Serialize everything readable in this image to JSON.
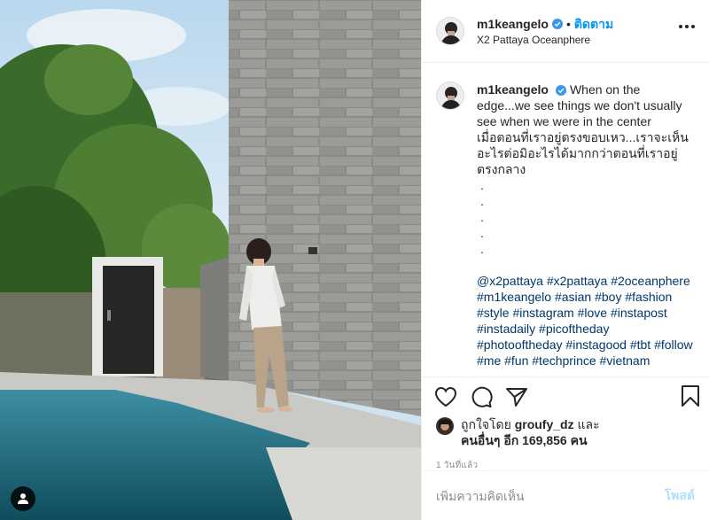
{
  "post": {
    "username": "m1keangelo",
    "follow_label": "ติดตาม",
    "location": "X2 Pattaya Oceanphere"
  },
  "caption": {
    "english": "When on the edge...we see things we don't usually see when we were in the center",
    "thai": "เมื่อตอนที่เราอยู่ตรงขอบเหว...เราจะเห็นอะไรต่อมิอะไรได้มากกว่าตอนที่เราอยู่ตรงกลาง",
    "dots": [
      ".",
      ".",
      ".",
      ".",
      "."
    ],
    "hashtags": [
      "@x2pattaya",
      "#x2pattaya",
      "#2oceanphere",
      "#m1keangelo",
      "#asian",
      "#boy",
      "#fashion",
      "#style",
      "#instagram",
      "#love",
      "#instapost",
      "#instadaily",
      "#picoftheday",
      "#photooftheday",
      "#instagood",
      "#tbt",
      "#follow",
      "#me",
      "#fun",
      "#techprince",
      "#vietnam"
    ]
  },
  "likes": {
    "prefix": "ถูกใจโดย",
    "liker": "groufy_dz",
    "conj": "และ",
    "others": "คนอื่นๆ อีก 169,856 คน"
  },
  "timestamp": "1 วันที่แล้ว",
  "comment": {
    "placeholder": "เพิ่มความคิดเห็น",
    "post_label": "โพสต์"
  },
  "colors": {
    "accent": "#0095f6",
    "verified": "#3897f0",
    "hashtag": "#00376b",
    "post_disabled": "#b2dffc"
  }
}
